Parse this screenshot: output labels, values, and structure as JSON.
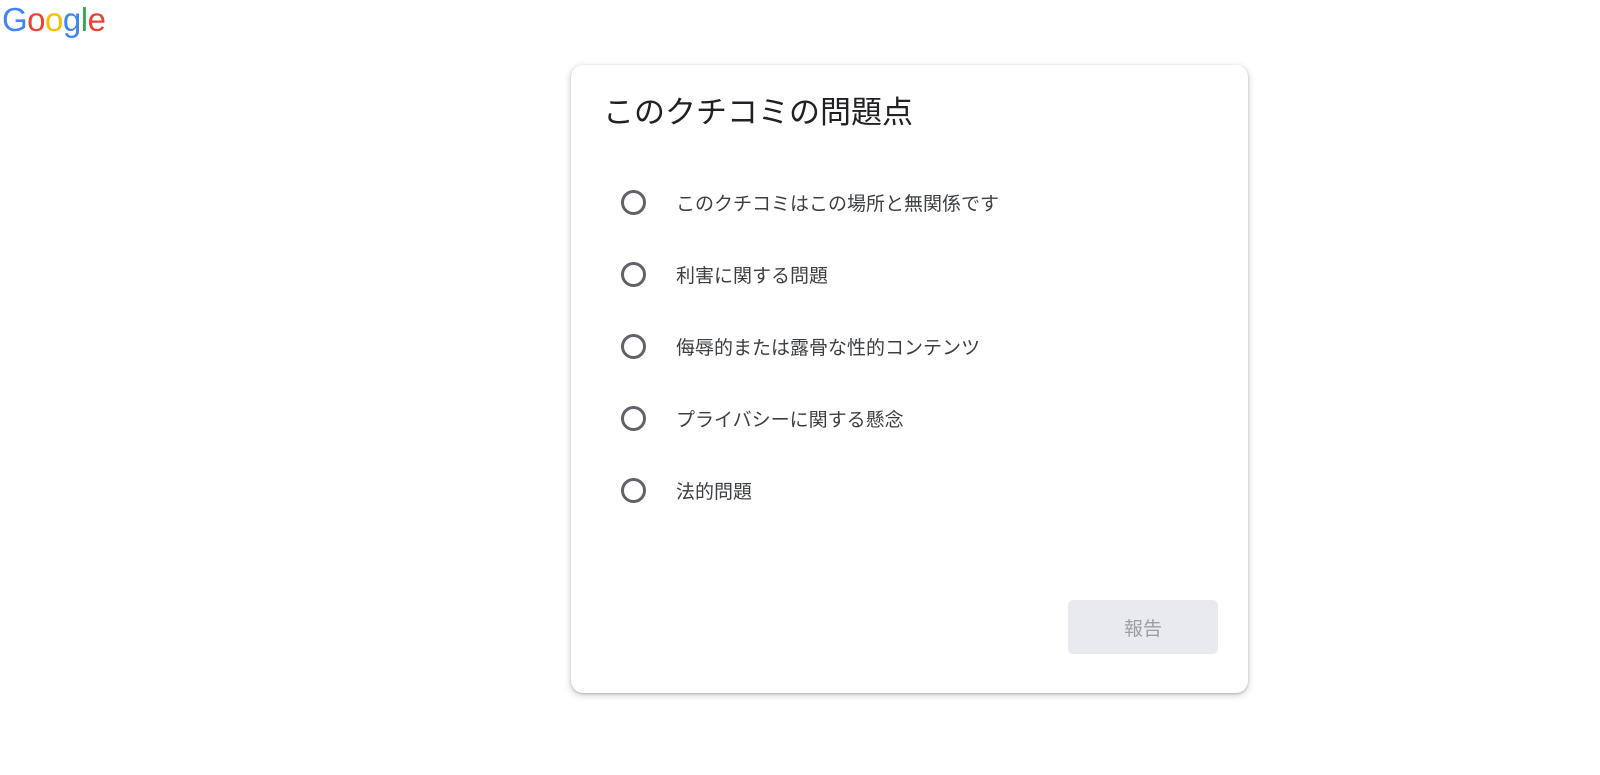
{
  "logo": {
    "letters": [
      "G",
      "o",
      "o",
      "g",
      "l",
      "e"
    ],
    "colors": [
      "#4285f4",
      "#ea4335",
      "#fbbc05",
      "#4285f4",
      "#34a853",
      "#ea4335"
    ]
  },
  "dialog": {
    "title": "このクチコミの問題点",
    "options": [
      {
        "label": "このクチコミはこの場所と無関係です",
        "selected": false
      },
      {
        "label": "利害に関する問題",
        "selected": false
      },
      {
        "label": "侮辱的または露骨な性的コンテンツ",
        "selected": false
      },
      {
        "label": "プライバシーに関する懸念",
        "selected": false
      },
      {
        "label": "法的問題",
        "selected": false
      }
    ],
    "submit_label": "報告",
    "submit_disabled": true
  },
  "colors": {
    "radio_border": "#5f6368",
    "button_bg_disabled": "#e8eaed",
    "button_text_disabled": "#9aa0a6"
  }
}
